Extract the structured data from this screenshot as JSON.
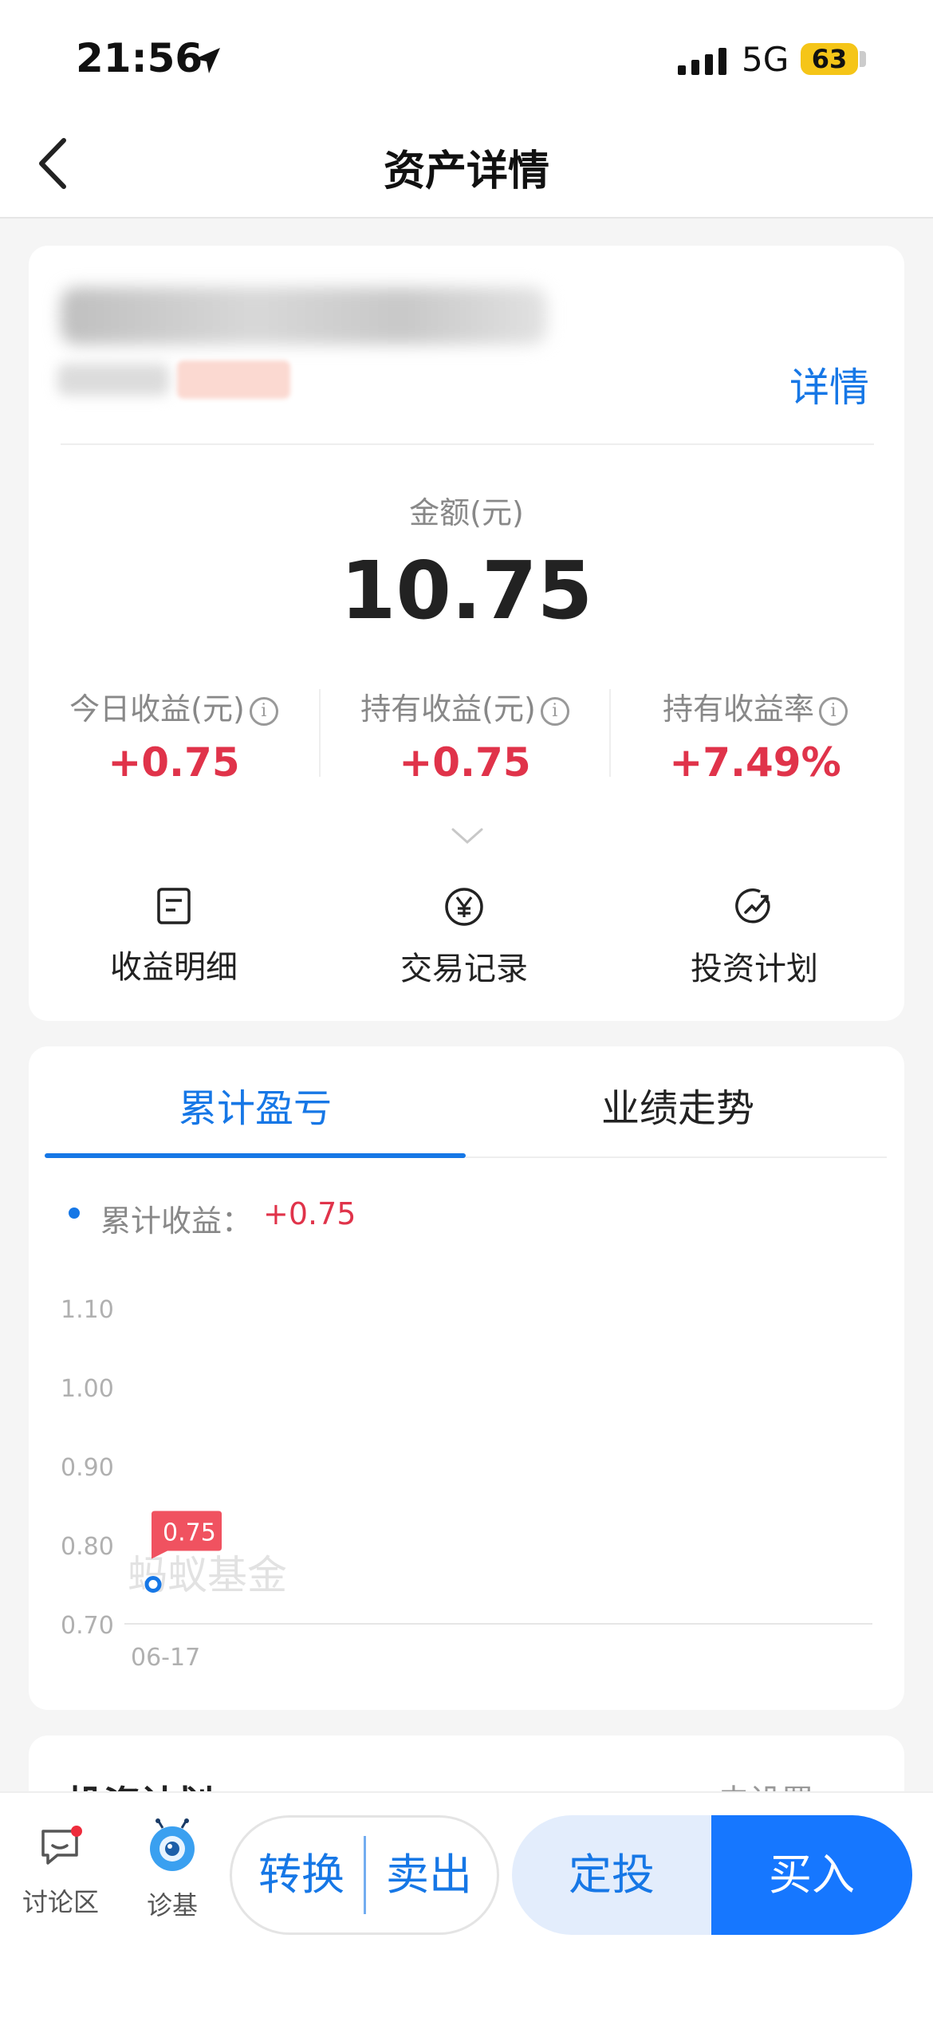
{
  "status_bar": {
    "time": "21:56",
    "network": "5G",
    "battery": "63"
  },
  "nav": {
    "title": "资产详情"
  },
  "asset_card": {
    "detail_link": "详情",
    "amount_label": "金额(元)",
    "amount": "10.75",
    "stats": [
      {
        "label": "今日收益(元)",
        "value": "+0.75"
      },
      {
        "label": "持有收益(元)",
        "value": "+0.75"
      },
      {
        "label": "持有收益率",
        "value": "+7.49%"
      }
    ],
    "actions": [
      {
        "label": "收益明细",
        "icon": "document-icon"
      },
      {
        "label": "交易记录",
        "icon": "yen-circle-icon"
      },
      {
        "label": "投资计划",
        "icon": "trend-circle-icon"
      }
    ]
  },
  "chart_card": {
    "tabs": [
      "累计盈亏",
      "业绩走势"
    ],
    "legend_label": "累计收益：",
    "legend_value": "+0.75",
    "watermark": "蚂蚁基金"
  },
  "chart_data": {
    "type": "line",
    "x": [
      "06-17"
    ],
    "series": [
      {
        "values": [
          0.75
        ]
      }
    ],
    "y_ticks": [
      "1.10",
      "1.00",
      "0.90",
      "0.80",
      "0.70"
    ],
    "ylim": [
      0.7,
      1.1
    ],
    "point_label": "0.75",
    "colors": {
      "line": "#1677e6",
      "label_bg": "#f05260"
    }
  },
  "plan_card": {
    "title": "投资计划",
    "right": "去设置"
  },
  "bottom_bar": {
    "discussion": "讨论区",
    "diagnose": "诊基",
    "convert": "转换",
    "sell": "卖出",
    "auto_invest": "定投",
    "buy": "买入"
  }
}
